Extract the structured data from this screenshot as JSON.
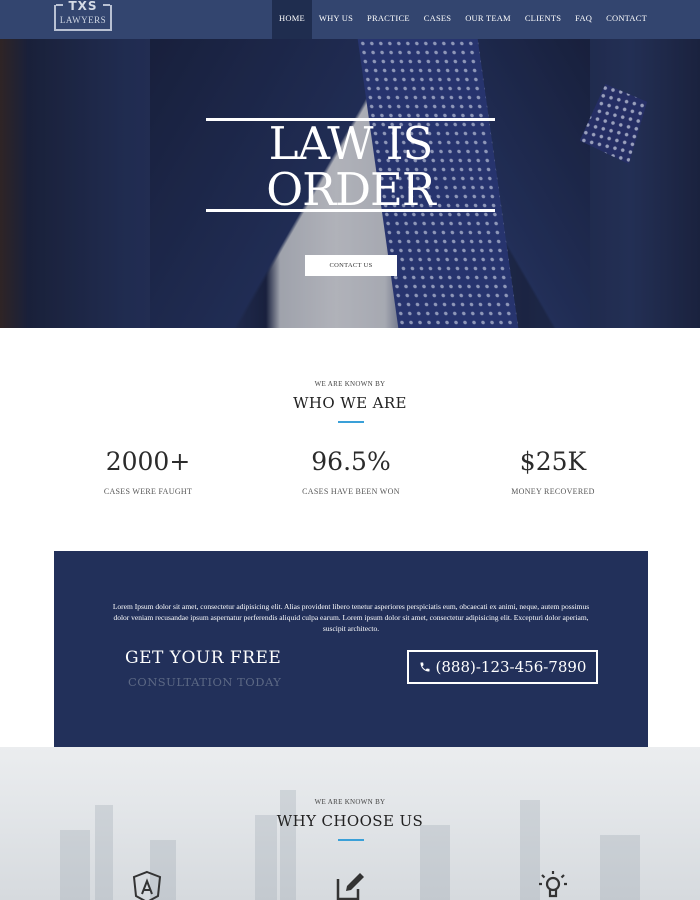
{
  "brand": {
    "line1": "TXS",
    "line2": "LAWYERS"
  },
  "nav": {
    "items": [
      {
        "label": "HOME",
        "active": true
      },
      {
        "label": "WHY US"
      },
      {
        "label": "PRACTICE"
      },
      {
        "label": "CASES"
      },
      {
        "label": "OUR TEAM"
      },
      {
        "label": "CLIENTS"
      },
      {
        "label": "FAQ"
      },
      {
        "label": "CONTACT"
      }
    ]
  },
  "hero": {
    "line1": "LAW IS",
    "line2": "ORDER",
    "button": "CONTACT US"
  },
  "about": {
    "kicker": "WE ARE KNOWN BY",
    "title": "WHO WE ARE",
    "stats": [
      {
        "value": "2000+",
        "label": "CASES WERE FAUGHT"
      },
      {
        "value": "96.5%",
        "label": "CASES HAVE BEEN WON"
      },
      {
        "value": "$25K",
        "label": "MONEY RECOVERED"
      }
    ]
  },
  "cta": {
    "text": "Lorem Ipsum dolor sit amet, consectetur adipisicing elit. Alias provident libero tenetur asperiores perspiciatis eum, obcaecati ex animi, neque, autem possimus dolor veniam recusandae ipsum aspernatur perferendis aliquid culpa earum. Lorem ipsum dolor sit amet, consectetur adipisicing elit. Excepturi dolor aperiam, suscipit architecto.",
    "heading": "GET YOUR FREE",
    "subheading": "CONSULTATION TODAY",
    "phone": "(888)-123-456-7890"
  },
  "why": {
    "kicker": "WE ARE KNOWN BY",
    "title": "WHY CHOOSE US",
    "icons": [
      "shield-a-icon",
      "edit-icon",
      "lightbulb-icon"
    ]
  },
  "colors": {
    "nav": "#33456f",
    "accent": "#3aa0d8",
    "cta": "#22305a"
  }
}
